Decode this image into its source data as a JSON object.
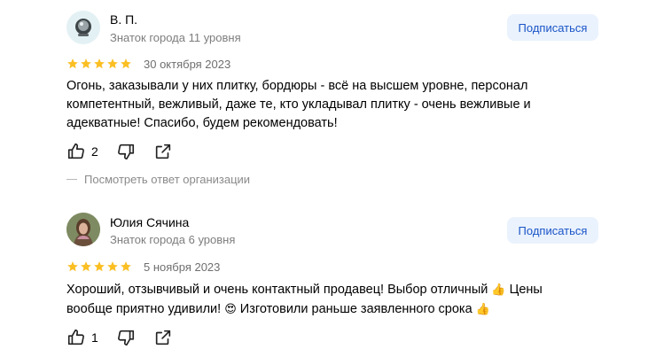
{
  "reviews": [
    {
      "author": "В. П.",
      "level": "Знаток города 11 уровня",
      "subscribe_label": "Подписаться",
      "rating": 5,
      "date": "30 октября 2023",
      "text": "Огонь, заказывали у них плитку, бордюры - всё на высшем уровне, персонал компетентный, вежливый, даже те, кто укладывал плитку - очень вежливые и адекватные! Спасибо, будем рекомендовать!",
      "likes": "2",
      "org_reply_link": "Посмотреть ответ организации"
    },
    {
      "author": "Юлия Сячина",
      "level": "Знаток города 6 уровня",
      "subscribe_label": "Подписаться",
      "rating": 5,
      "date": "5 ноября 2023",
      "text_part1": "Хороший, отзывчивый и очень контактный продавец! Выбор отличный",
      "emoji1": "👍",
      "text_part2": "Цены вообще приятно удивили!",
      "emoji2": "😍",
      "text_part3": "Изготовили раньше заявленного срока",
      "emoji3": "👍",
      "likes": "1"
    }
  ],
  "colors": {
    "star": "#fbbf24",
    "subscribe_bg": "#eaf2fd",
    "subscribe_text": "#1a55c7",
    "secondary_text": "#7d7d7d"
  },
  "icons": [
    "like-icon",
    "dislike-icon",
    "share-icon",
    "star-icon"
  ]
}
